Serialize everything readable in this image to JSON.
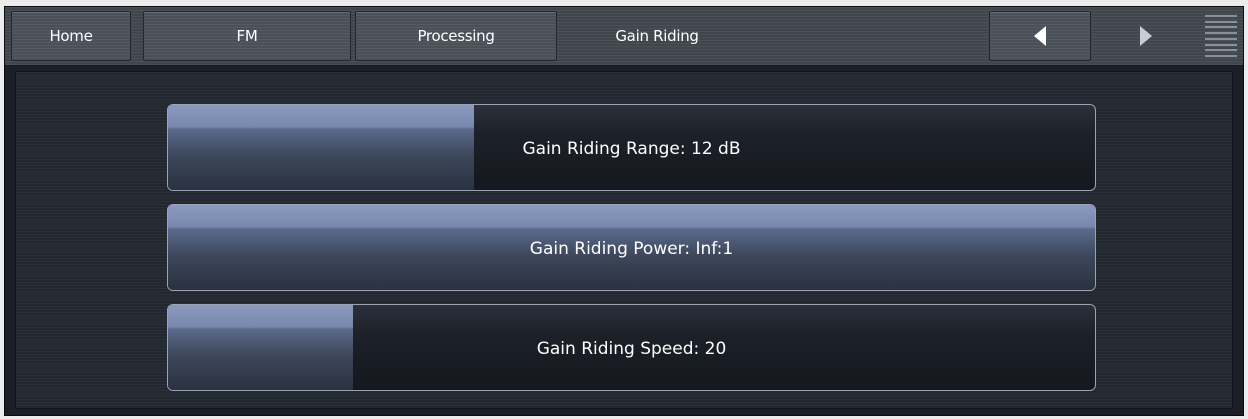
{
  "nav": {
    "home": "Home",
    "fm": "FM",
    "processing": "Processing",
    "current": "Gain Riding"
  },
  "icons": {
    "back": "arrow-left-icon",
    "forward": "arrow-right-icon",
    "menu": "menu-icon"
  },
  "controls": [
    {
      "label": "Gain Riding Range: 12 dB",
      "fill_fraction": 0.33
    },
    {
      "label": "Gain Riding Power: Inf:1",
      "fill_fraction": 1.0
    },
    {
      "label": "Gain Riding Speed: 20",
      "fill_fraction": 0.2
    }
  ],
  "colors": {
    "fill_accent": "#8a9ac0",
    "background": "#232830"
  }
}
